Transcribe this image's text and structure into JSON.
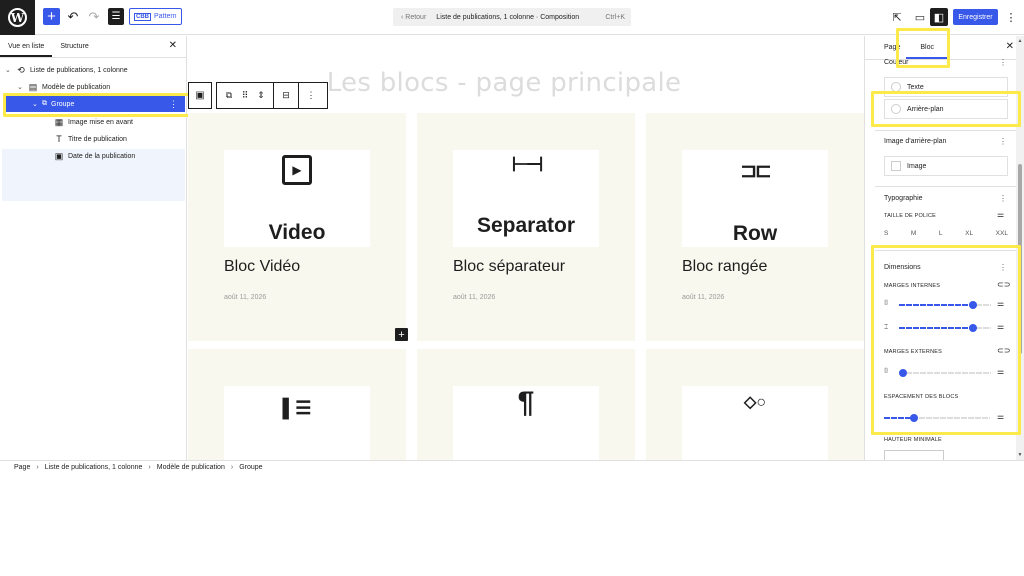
{
  "topbar": {
    "logo": "wordpress-logo",
    "add_icon": "+",
    "undo_icon": "↶",
    "redo_icon": "↷",
    "doc_overview_icon": "☰",
    "pattern_badge": "CBB",
    "pattern_label": "Pattern",
    "command_back": "‹ Retour",
    "command_title": "Liste de publications, 1 colonne · Composition",
    "command_shortcut": "Ctrl+K",
    "view_icon": "⇱",
    "device_icon": "▭",
    "settings_icon": "◧",
    "save_label": "Enregistrer",
    "more_icon": "⋮"
  },
  "list_view": {
    "tabs": [
      "Vue en liste",
      "Structure"
    ],
    "active_tab": "Vue en liste",
    "close_icon": "✕",
    "items": [
      {
        "label": "Liste de publications, 1 colonne",
        "icon": "⟲"
      },
      {
        "label": "Modèle de publication",
        "icon": "▤"
      },
      {
        "label": "Groupe",
        "icon": "⧉",
        "selected": true
      },
      {
        "label": "Image mise en avant",
        "icon": "▦"
      },
      {
        "label": "Titre de publication",
        "icon": "T"
      },
      {
        "label": "Date de la publication",
        "icon": "▣"
      }
    ]
  },
  "canvas": {
    "heading": "Les blocs - page principale",
    "cards": [
      {
        "thumb_label": "Video",
        "icon": "▶",
        "title": "Bloc Vidéo",
        "date": "août 11, 2026"
      },
      {
        "thumb_label": "Separator",
        "icon": "⊢⊣",
        "title": "Bloc séparateur",
        "date": "août 11, 2026"
      },
      {
        "thumb_label": "Row",
        "icon": "⊐⊏",
        "title": "Bloc rangée",
        "date": "août 11, 2026"
      },
      {
        "thumb_label": "",
        "icon": "▌☰",
        "title": "",
        "date": ""
      },
      {
        "thumb_label": "",
        "icon": "¶",
        "title": "",
        "date": ""
      },
      {
        "thumb_label": "",
        "icon": "◇○",
        "title": "",
        "date": ""
      }
    ],
    "toolbar": {
      "parent_icon": "▣",
      "transform_icon": "⧉",
      "drag_icon": "⠿",
      "move_icon": "⇕",
      "align_icon": "⊟",
      "options_icon": "⋮"
    },
    "inserter_icon": "+"
  },
  "settings": {
    "tabs": [
      "Page",
      "Bloc"
    ],
    "active_tab": "Bloc",
    "close_icon": "✕",
    "color_section": "Couleur",
    "color_items": [
      "Texte",
      "Arrière-plan"
    ],
    "bg_image_section": "Image d'arrière-plan",
    "bg_image_item": "Image",
    "typography_section": "Typographie",
    "font_size_caption": "Taille de police",
    "font_sizes": [
      "S",
      "M",
      "L",
      "XL",
      "XXL"
    ],
    "dimensions_section": "Dimensions",
    "padding_caption": "Marges internes",
    "margin_caption": "Marges externes",
    "block_spacing_caption": "Espacement des blocs",
    "min_height_caption": "Hauteur minimale",
    "sliders": {
      "padding_vertical": 0.8,
      "padding_horizontal": 0.8,
      "margin_vertical": 0.0,
      "block_spacing": 0.28
    }
  },
  "breadcrumb": [
    "Page",
    "Liste de publications, 1 colonne",
    "Modèle de publication",
    "Groupe"
  ],
  "colors": {
    "accent": "#3858e9",
    "highlight": "#fce94a",
    "card_bg": "#f9f8ef",
    "dark": "#1e1e1e"
  }
}
